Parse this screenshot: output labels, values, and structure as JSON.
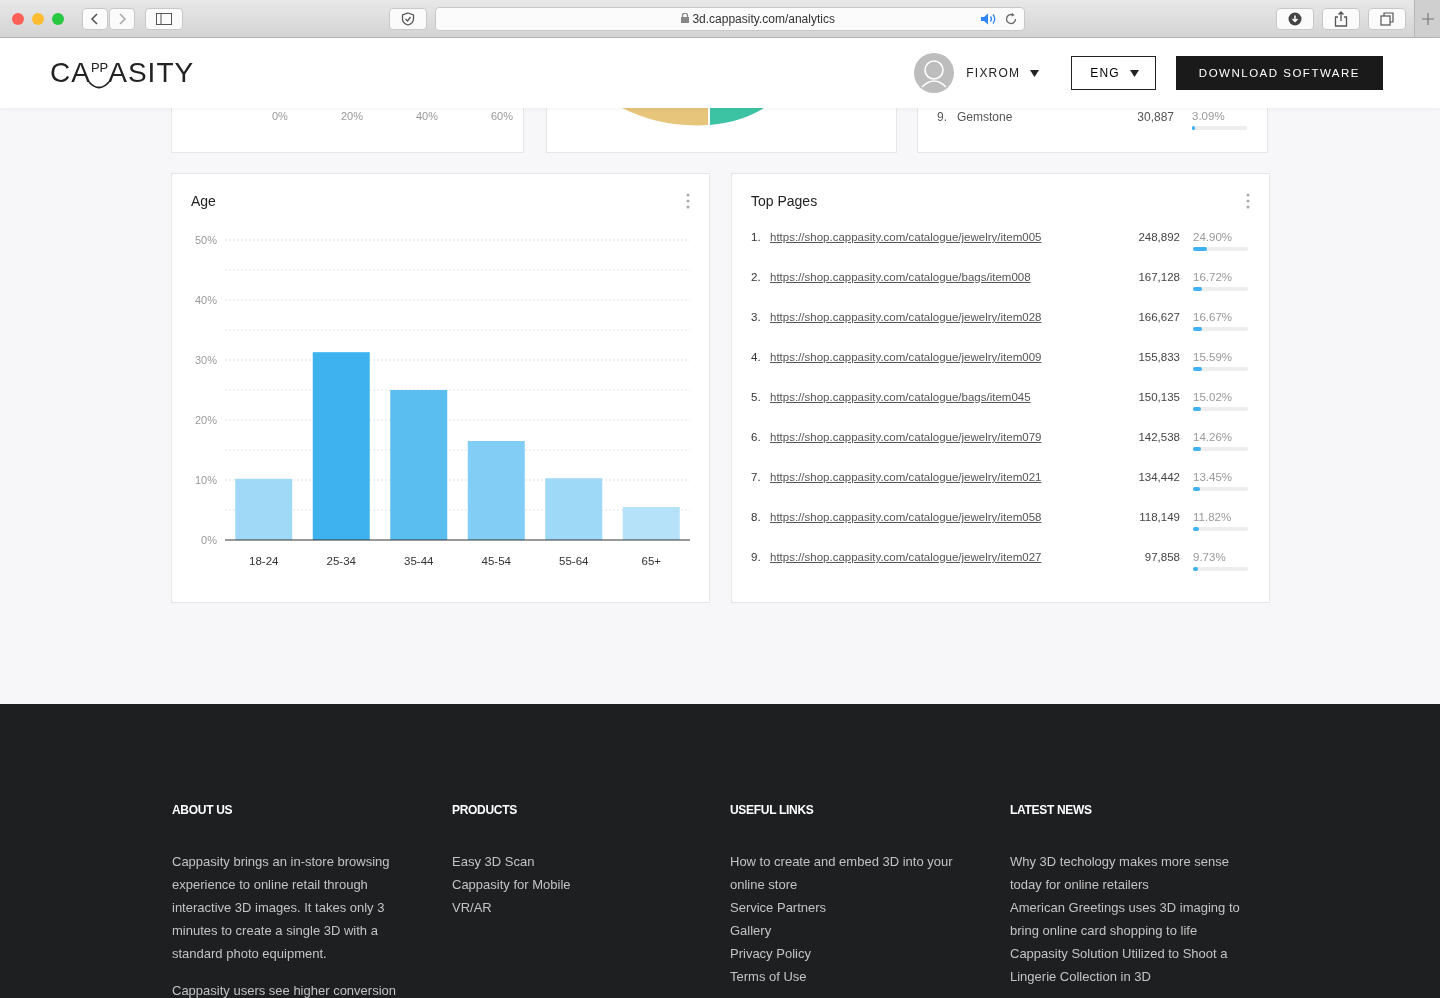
{
  "browser": {
    "url": "3d.cappasity.com/analytics"
  },
  "header": {
    "logo": "CA$^{PP}$ASITY",
    "user": "FIXROM",
    "language": "ENG",
    "download": "DOWNLOAD SOFTWARE"
  },
  "partial_cards": {
    "axis_ticks": [
      "0%",
      "20%",
      "40%",
      "60%"
    ],
    "list_row": {
      "index": "9.",
      "name": "Gemstone",
      "visits": "30,887",
      "percent": "3.09%",
      "level": 0.03
    }
  },
  "age_card": {
    "title": "Age",
    "chart_data": {
      "type": "bar",
      "categories": [
        "18-24",
        "25-34",
        "35-44",
        "45-54",
        "55-64",
        "65+"
      ],
      "values": [
        10.2,
        31.3,
        25,
        16.5,
        10.3,
        5.5
      ],
      "grid": true,
      "ylim": [
        0,
        50
      ],
      "yticks": [
        {
          "value": 0,
          "label": "0%"
        },
        {
          "value": 10,
          "label": "10%"
        },
        {
          "value": 20,
          "label": "20%"
        },
        {
          "value": 30,
          "label": "30%"
        },
        {
          "value": 40,
          "label": "40%"
        },
        {
          "value": 50,
          "label": "50%"
        }
      ]
    }
  },
  "top_pages": {
    "title": "Top Pages",
    "rows": [
      {
        "index": "1.",
        "url": "https://shop.cappasity.com/catalogue/jewelry/item005",
        "visits": "248,892",
        "percent": "24.90%",
        "level": 0.249
      },
      {
        "index": "2.",
        "url": "https://shop.cappasity.com/catalogue/bags/item008",
        "visits": "167,128",
        "percent": "16.72%",
        "level": 0.167
      },
      {
        "index": "3.",
        "url": "https://shop.cappasity.com/catalogue/jewelry/item028",
        "visits": "166,627",
        "percent": "16.67%",
        "level": 0.167
      },
      {
        "index": "4.",
        "url": "https://shop.cappasity.com/catalogue/jewelry/item009",
        "visits": "155,833",
        "percent": "15.59%",
        "level": 0.156
      },
      {
        "index": "5.",
        "url": "https://shop.cappasity.com/catalogue/bags/item045",
        "visits": "150,135",
        "percent": "15.02%",
        "level": 0.15
      },
      {
        "index": "6.",
        "url": "https://shop.cappasity.com/catalogue/jewelry/item079",
        "visits": "142,538",
        "percent": "14.26%",
        "level": 0.143
      },
      {
        "index": "7.",
        "url": "https://shop.cappasity.com/catalogue/jewelry/item021",
        "visits": "134,442",
        "percent": "13.45%",
        "level": 0.135
      },
      {
        "index": "8.",
        "url": "https://shop.cappasity.com/catalogue/jewelry/item058",
        "visits": "118,149",
        "percent": "11.82%",
        "level": 0.118
      },
      {
        "index": "9.",
        "url": "https://shop.cappasity.com/catalogue/jewelry/item027",
        "visits": "97,858",
        "percent": "9.73%",
        "level": 0.097
      }
    ]
  },
  "footer": {
    "columns": [
      {
        "heading": "ABOUT US",
        "kind": "text",
        "items": [
          "Cappasity brings an in-store browsing experience to online retail through interactive 3D images. It takes only 3 minutes to create a single 3D with a standard photo equipment.",
          "Cappasity users see higher conversion"
        ]
      },
      {
        "heading": "PRODUCTS",
        "kind": "links",
        "items": [
          "Easy 3D Scan",
          "Cappasity for Mobile",
          "VR/AR"
        ]
      },
      {
        "heading": "USEFUL LINKS",
        "kind": "links",
        "items": [
          "How to create and embed 3D into your online store",
          "Service Partners",
          "Gallery",
          "Privacy Policy",
          "Terms of Use"
        ]
      },
      {
        "heading": "LATEST NEWS",
        "kind": "links",
        "items": [
          "Why 3D techology makes more sense today for online retailers",
          "American Greetings uses 3D imaging to bring online card shopping to life",
          "Cappasity Solution Utilized to Shoot a Lingerie Collection in 3D"
        ]
      }
    ]
  }
}
